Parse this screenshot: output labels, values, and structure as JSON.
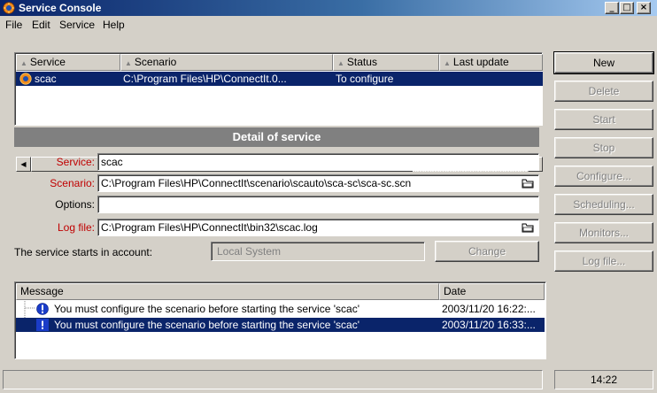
{
  "window": {
    "title": "Service Console",
    "controls": [
      "_",
      "□",
      "×"
    ]
  },
  "menu": [
    "File",
    "Edit",
    "Service",
    "Help"
  ],
  "service_table": {
    "columns": [
      "Service",
      "Scenario",
      "Status",
      "Last update"
    ],
    "rows": [
      {
        "service": "scac",
        "scenario": "C:\\Program Files\\HP\\ConnectIt.0...",
        "status": "To configure",
        "last_update": ""
      }
    ]
  },
  "detail": {
    "title": "Detail of service",
    "service_label": "Service:",
    "service_value": "scac",
    "scenario_label": "Scenario:",
    "scenario_value": "C:\\Program Files\\HP\\ConnectIt\\scenario\\scauto\\sca-sc\\sca-sc.scn",
    "options_label": "Options:",
    "options_value": "",
    "logfile_label": "Log file:",
    "logfile_value": "C:\\Program Files\\HP\\ConnectIt\\bin32\\scac.log",
    "account_label": "The service starts in account:",
    "account_value": "Local System",
    "change_label": "Change"
  },
  "buttons": {
    "new": "New",
    "delete": "Delete",
    "start": "Start",
    "stop": "Stop",
    "configure": "Configure...",
    "scheduling": "Scheduling...",
    "monitors": "Monitors...",
    "logfile": "Log file..."
  },
  "messages": {
    "columns": [
      "Message",
      "Date"
    ],
    "rows": [
      {
        "text": "You must configure the scenario before starting the service 'scac'",
        "date": "2003/11/20 16:22:..."
      },
      {
        "text": "You must configure the scenario before starting the service 'scac'",
        "date": "2003/11/20 16:33:..."
      }
    ]
  },
  "statusbar": {
    "time": "14:22"
  },
  "colors": {
    "titlebar": "#0a246a",
    "selection": "#0a246a",
    "required_label": "#c00000",
    "detail_header": "#808080"
  }
}
